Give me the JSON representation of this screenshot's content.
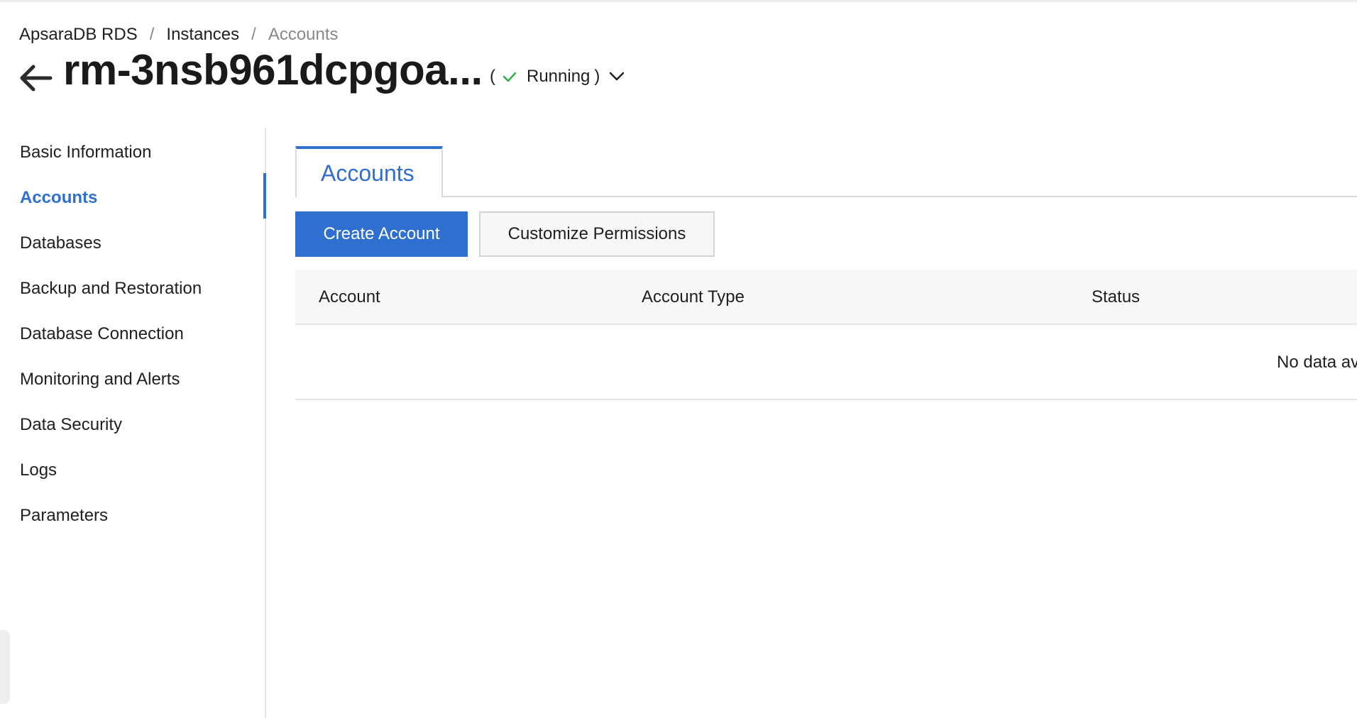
{
  "breadcrumb": {
    "items": [
      {
        "label": "ApsaraDB RDS"
      },
      {
        "label": "Instances"
      },
      {
        "label": "Accounts"
      }
    ],
    "separator": "/"
  },
  "header": {
    "title": "rm-3nsb961dcpgoa...",
    "status": {
      "paren_open": "(",
      "label": "Running",
      "paren_close": ")",
      "icon": "check-icon",
      "icon_color": "#2fb344"
    }
  },
  "sidebar": {
    "active_color": "#2f6fd0",
    "items": [
      {
        "label": "Basic Information"
      },
      {
        "label": "Accounts",
        "active": true
      },
      {
        "label": "Databases"
      },
      {
        "label": "Backup and Restoration"
      },
      {
        "label": "Database Connection"
      },
      {
        "label": "Monitoring and Alerts"
      },
      {
        "label": "Data Security"
      },
      {
        "label": "Logs"
      },
      {
        "label": "Parameters"
      }
    ]
  },
  "main": {
    "tabs": [
      {
        "label": "Accounts",
        "active": true
      }
    ],
    "toolbar": {
      "create_label": "Create Account",
      "customize_label": "Customize Permissions"
    },
    "table": {
      "columns": [
        "Account",
        "Account Type",
        "Status"
      ],
      "empty_text": "No data av"
    }
  }
}
